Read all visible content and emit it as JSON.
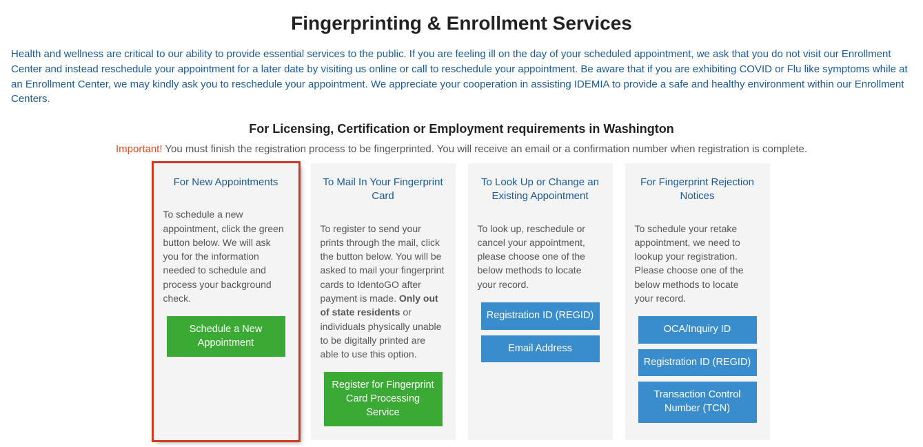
{
  "page_title": "Fingerprinting & Enrollment Services",
  "notice_text": "Health and wellness are critical to our ability to provide essential services to the public. If you are feeling ill on the day of your scheduled appointment, we ask that you do not visit our Enrollment Center and instead reschedule your appointment for a later date by visiting us online or call to reschedule your appointment. Be aware that if you are exhibiting COVID or Flu like symptoms while at an Enrollment Center, we may kindly ask you to reschedule your appointment. We appreciate your cooperation in assisting IDEMIA to provide a safe and healthy environment within our Enrollment Centers.",
  "subheading": "For Licensing, Certification or Employment requirements in Washington",
  "important_label": "Important!",
  "important_text": " You must finish the registration process to be fingerprinted. You will receive an email or a confirmation number when registration is complete.",
  "cards": {
    "new_appt": {
      "title": "For New Appointments",
      "text": "To schedule a new appointment, click the green button below. We will ask you for the information needed to schedule and process your background check.",
      "button": "Schedule a New Appointment"
    },
    "mail_in": {
      "title": "To Mail In Your Fingerprint Card",
      "text_before": "To register to send your prints through the mail, click the button below. You will be asked to mail your fingerprint cards to IdentoGO after payment is made. ",
      "text_bold": "Only out of state residents",
      "text_after": " or individuals physically unable to be digitally printed are able to use this option.",
      "button": "Register for Fingerprint Card Processing Service"
    },
    "lookup": {
      "title": "To Look Up or Change an Existing Appointment",
      "text": "To look up, reschedule or cancel your appointment, please choose one of the below methods to locate your record.",
      "btn_regid": "Registration ID (REGID)",
      "btn_email": "Email Address"
    },
    "rejection": {
      "title": "For Fingerprint Rejection Notices",
      "text": "To schedule your retake appointment, we need to lookup your registration. Please choose one of the below methods to locate your record.",
      "btn_oca": "OCA/Inquiry ID",
      "btn_regid": "Registration ID (REGID)",
      "btn_tcn": "Transaction Control Number (TCN)"
    }
  }
}
